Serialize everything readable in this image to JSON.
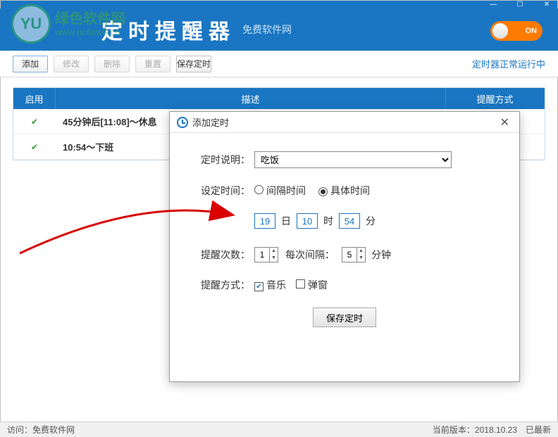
{
  "watermark": {
    "text": "绿色软件网",
    "url": "www.pc6sw9.cn"
  },
  "header": {
    "title": "定时提醒器",
    "subtitle": "免费软件网",
    "toggle": "ON"
  },
  "toolbar": {
    "add": "添加",
    "edit": "修改",
    "del": "删除",
    "reset": "重置",
    "save": "保存定时",
    "status": "定时器正常运行中"
  },
  "table": {
    "th_enable": "启用",
    "th_desc": "描述",
    "th_mode": "提醒方式",
    "rows": [
      {
        "desc": "45分钟后[11:08]～休息"
      },
      {
        "desc": "10:54～下班"
      }
    ]
  },
  "dialog": {
    "title": "添加定时",
    "label_desc": "定时说明：",
    "desc_value": "吃饭",
    "label_time": "设定时间：",
    "radio_interval": "间隔时间",
    "radio_specific": "具体时间",
    "day": "19",
    "unit_day": "日",
    "hour": "10",
    "unit_hour": "时",
    "minute": "54",
    "unit_min": "分",
    "label_count": "提醒次数：",
    "count": "1",
    "label_every": "每次间隔：",
    "every": "5",
    "unit_every": "分钟",
    "label_mode": "提醒方式：",
    "chk_music": "音乐",
    "chk_popup": "弹窗",
    "save": "保存定时"
  },
  "statusbar": {
    "left": "访问：免费软件网",
    "version": "当前版本：2018.10.23",
    "latest": "已最新"
  }
}
